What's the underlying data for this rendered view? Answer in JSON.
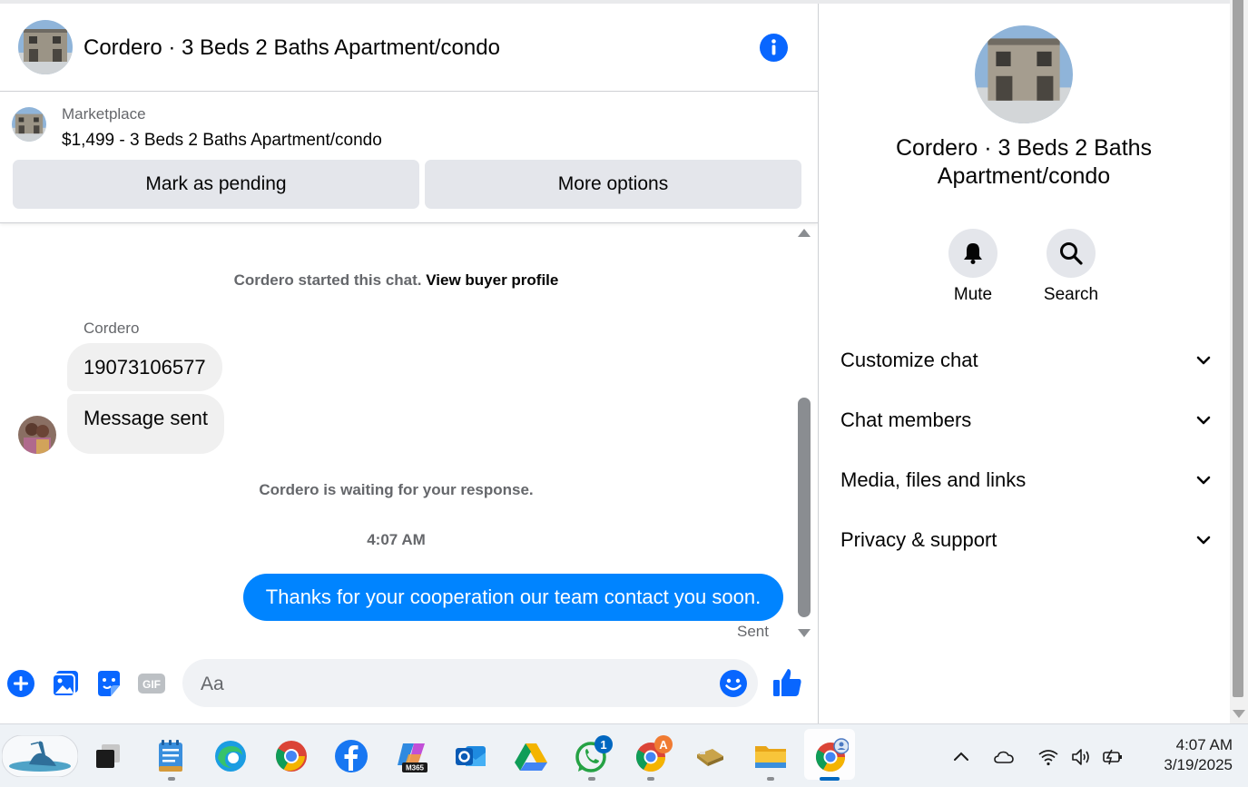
{
  "header": {
    "title": "Cordero · 3 Beds 2 Baths Apartment/condo",
    "info_icon": "info-icon"
  },
  "listing": {
    "kicker": "Marketplace",
    "title": "$1,499 - 3 Beds 2 Baths Apartment/condo",
    "pending_label": "Mark as pending",
    "more_label": "More options"
  },
  "messages": {
    "started_text": "Cordero started this chat.",
    "view_profile_link": "View buyer profile",
    "sender_name": "Cordero",
    "incoming": [
      "19073106577",
      "Message sent"
    ],
    "waiting_text": "Cordero is waiting for your response.",
    "timestamp": "4:07 AM",
    "outgoing": "Thanks for your cooperation our team contact you soon.",
    "status": "Sent"
  },
  "composer": {
    "placeholder": "Aa",
    "icons": [
      "plus-icon",
      "image-icon",
      "sticker-icon",
      "gif-icon",
      "emoji-icon",
      "thumbs-up-icon"
    ]
  },
  "right_panel": {
    "title": "Cordero · 3 Beds 2 Baths Apartment/condo",
    "mute_label": "Mute",
    "search_label": "Search",
    "sections": [
      "Customize chat",
      "Chat members",
      "Media, files and links",
      "Privacy & support"
    ]
  },
  "taskbar": {
    "apps": [
      "heron-wallpaper-widget",
      "task-view",
      "notepad",
      "edge",
      "chrome",
      "facebook",
      "m365-copilot",
      "outlook",
      "google-drive",
      "whatsapp",
      "chrome-profile",
      "usb-drive",
      "file-explorer",
      "chrome-active"
    ],
    "whatsapp_badge": "1",
    "chrome_badge": "A",
    "clock_time": "4:07 AM",
    "clock_date": "3/19/2025"
  },
  "colors": {
    "accent": "#0084ff",
    "fb_blue": "#1877f2",
    "bubble_in": "#f0f0f0",
    "button_bg": "#e4e6eb"
  }
}
